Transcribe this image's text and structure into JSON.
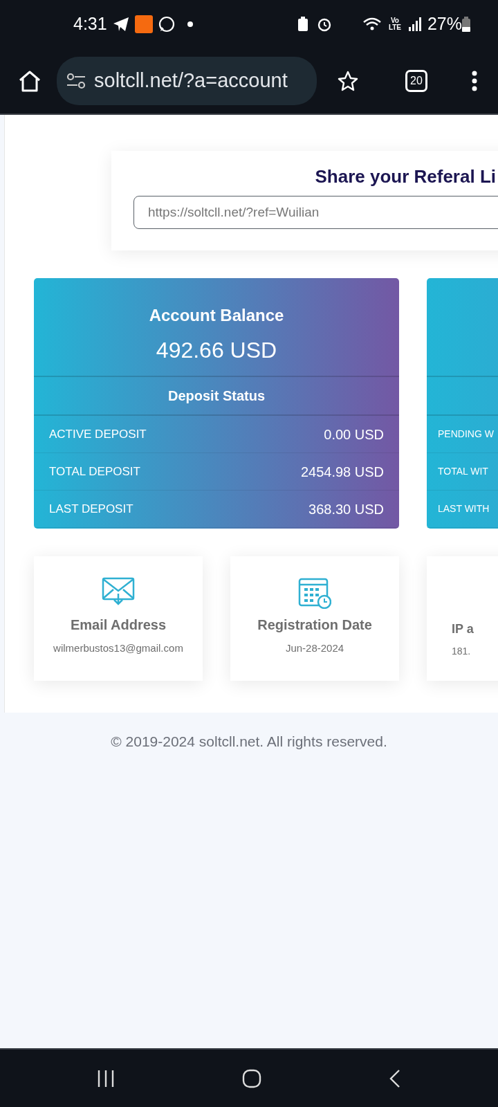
{
  "status_bar": {
    "time": "4:31",
    "network": "Vo LTE",
    "battery": "27%"
  },
  "browser": {
    "url": "soltcll.net/?a=account",
    "tab_count": "20"
  },
  "referral": {
    "title": "Share your Referal Li",
    "value": "https://soltcll.net/?ref=Wuilian"
  },
  "balance_card": {
    "title": "Account Balance",
    "amount": "492.66 USD",
    "section": "Deposit Status",
    "rows": [
      {
        "label": "ACTIVE DEPOSIT",
        "value": "0.00 USD"
      },
      {
        "label": "TOTAL DEPOSIT",
        "value": "2454.98 USD"
      },
      {
        "label": "LAST DEPOSIT",
        "value": "368.30 USD"
      }
    ]
  },
  "withdraw_card": {
    "rows": [
      "PENDING W",
      "TOTAL WIT",
      "LAST WITH"
    ]
  },
  "info_cards": [
    {
      "kind": "email",
      "title": "Email Address",
      "value": "wilmerbustos13@gmail.com"
    },
    {
      "kind": "calendar",
      "title": "Registration Date",
      "value": "Jun-28-2024"
    },
    {
      "kind": "ip",
      "title": "IP a",
      "value": "181."
    }
  ],
  "footer": "© 2019-2024 soltcll.net. All rights reserved."
}
